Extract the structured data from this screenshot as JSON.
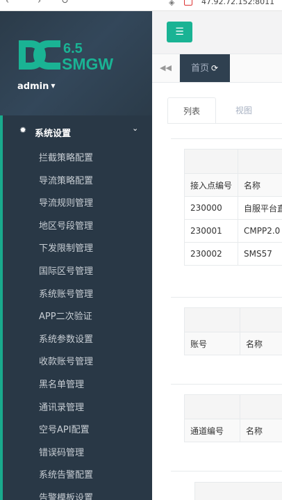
{
  "browser": {
    "url_partial": "47.92.72.152:8011",
    "nav_icons": [
      "back-icon",
      "forward-icon",
      "reload-icon"
    ]
  },
  "brand": {
    "logo_letters": "DC",
    "version": "6.5",
    "product": "SMGW",
    "color": "#1ab394"
  },
  "user": {
    "name": "admin"
  },
  "menu": {
    "section_label": "系统设置",
    "items": [
      "拦截策略配置",
      "导流策略配置",
      "导流规则管理",
      "地区号段管理",
      "下发限制管理",
      "国际区号管理",
      "系统账号管理",
      "APP二次验证",
      "系统参数设置",
      "收款账号管理",
      "黑名单管理",
      "通讯录管理",
      "空号API配置",
      "错误码管理",
      "系统告警配置",
      "告警模板设置"
    ]
  },
  "tabbar": {
    "home_label": "首页"
  },
  "content": {
    "tabs": [
      "列表",
      "视图"
    ],
    "table1": {
      "headers": [
        "接入点编号",
        "名称"
      ],
      "rows": [
        [
          "230000",
          "自服平台直连"
        ],
        [
          "230001",
          "CMPP2.0"
        ],
        [
          "230002",
          "SMS57"
        ]
      ]
    },
    "table2": {
      "headers": [
        "账号",
        "名称"
      ]
    },
    "table3": {
      "headers": [
        "通道编号",
        "名称"
      ]
    }
  },
  "colors": {
    "sidebar": "#2f4050",
    "menu_active": "#293846",
    "accent": "#1ab394"
  }
}
